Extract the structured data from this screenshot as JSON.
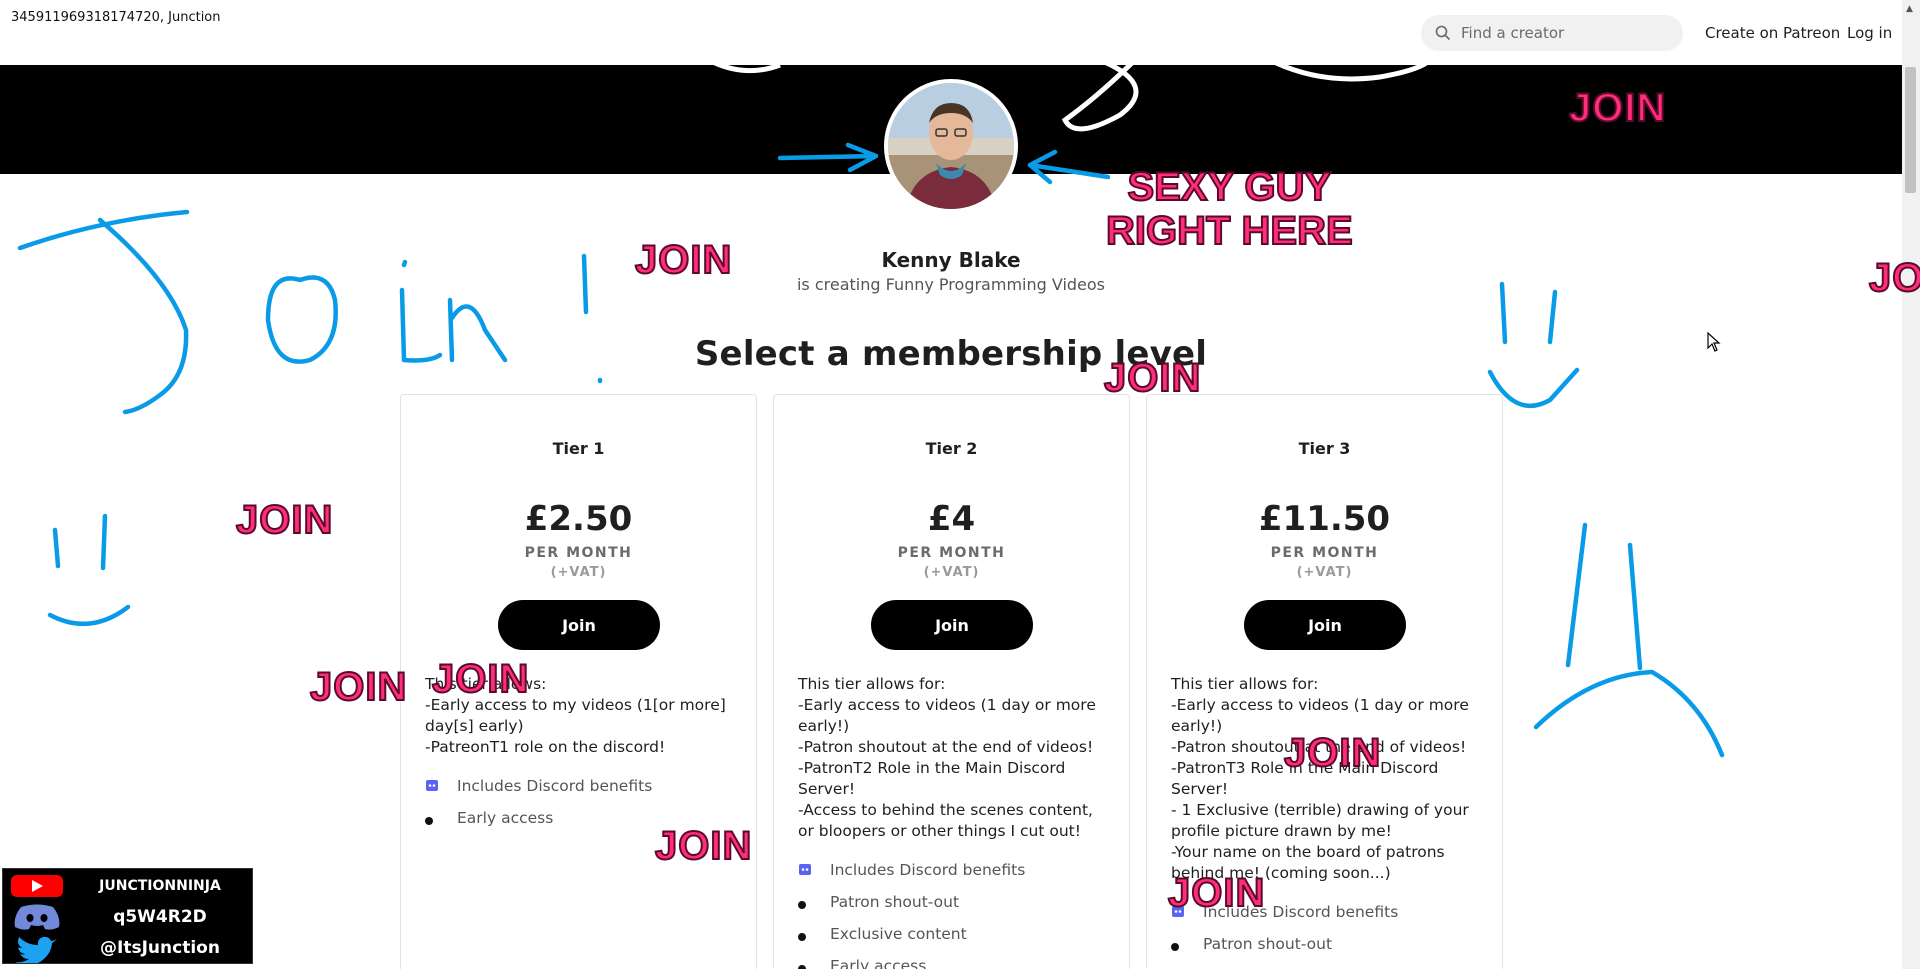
{
  "window": {
    "title": "345911969318174720, Junction"
  },
  "header": {
    "search_placeholder": "Find a creator",
    "create_link": "Create on Patreon",
    "login_link": "Log in"
  },
  "creator": {
    "name": "Kenny Blake",
    "subtitle": "is creating Funny Programming Videos"
  },
  "membership": {
    "heading": "Select a membership level",
    "tiers": [
      {
        "name": "Tier 1",
        "price": "£2.50",
        "period": "PER MONTH",
        "vat": "(+VAT)",
        "button": "Join",
        "description": "This tier allows:\n-Early access to my videos (1[or more] day[s] early)\n-PatreonT1 role on the discord!",
        "benefits": [
          "Includes Discord benefits",
          "Early access"
        ]
      },
      {
        "name": "Tier 2",
        "price": "£4",
        "period": "PER MONTH",
        "vat": "(+VAT)",
        "button": "Join",
        "description": "This tier allows for:\n-Early access to videos (1 day or more early!)\n-Patron shoutout at the end of videos!\n-PatronT2 Role in the Main Discord Server!\n-Access to behind the scenes content, or bloopers or other things I cut out!",
        "benefits": [
          "Includes Discord benefits",
          "Patron shout-out",
          "Exclusive content",
          "Early access"
        ]
      },
      {
        "name": "Tier 3",
        "price": "£11.50",
        "period": "PER MONTH",
        "vat": "(+VAT)",
        "button": "Join",
        "description": "This tier allows for:\n-Early access to videos (1 day or more early!)\n-Patron shoutout at the end of videos!\n-PatronT3 Role in the Main Discord Server!\n- 1 Exclusive (terrible) drawing of your profile picture drawn by me!\n-Your name on the board of patrons behind me! (coming soon...)",
        "benefits": [
          "Includes Discord benefits",
          "Patron shout-out"
        ]
      }
    ]
  },
  "overlay": {
    "join_text": "JOIN",
    "sexy_text": "SEXY GUY\nRIGHT HERE",
    "handwriting": "Join!"
  },
  "social": {
    "youtube": "JUNCTIONNINJA",
    "discord": "q5W4R2D",
    "twitter": "@ItsJunction"
  },
  "colors": {
    "pink": "#ff2d7a",
    "scribble_blue": "#0a9be8",
    "banner": "#000000",
    "button": "#000000",
    "discord_icon": "#5865f2"
  }
}
